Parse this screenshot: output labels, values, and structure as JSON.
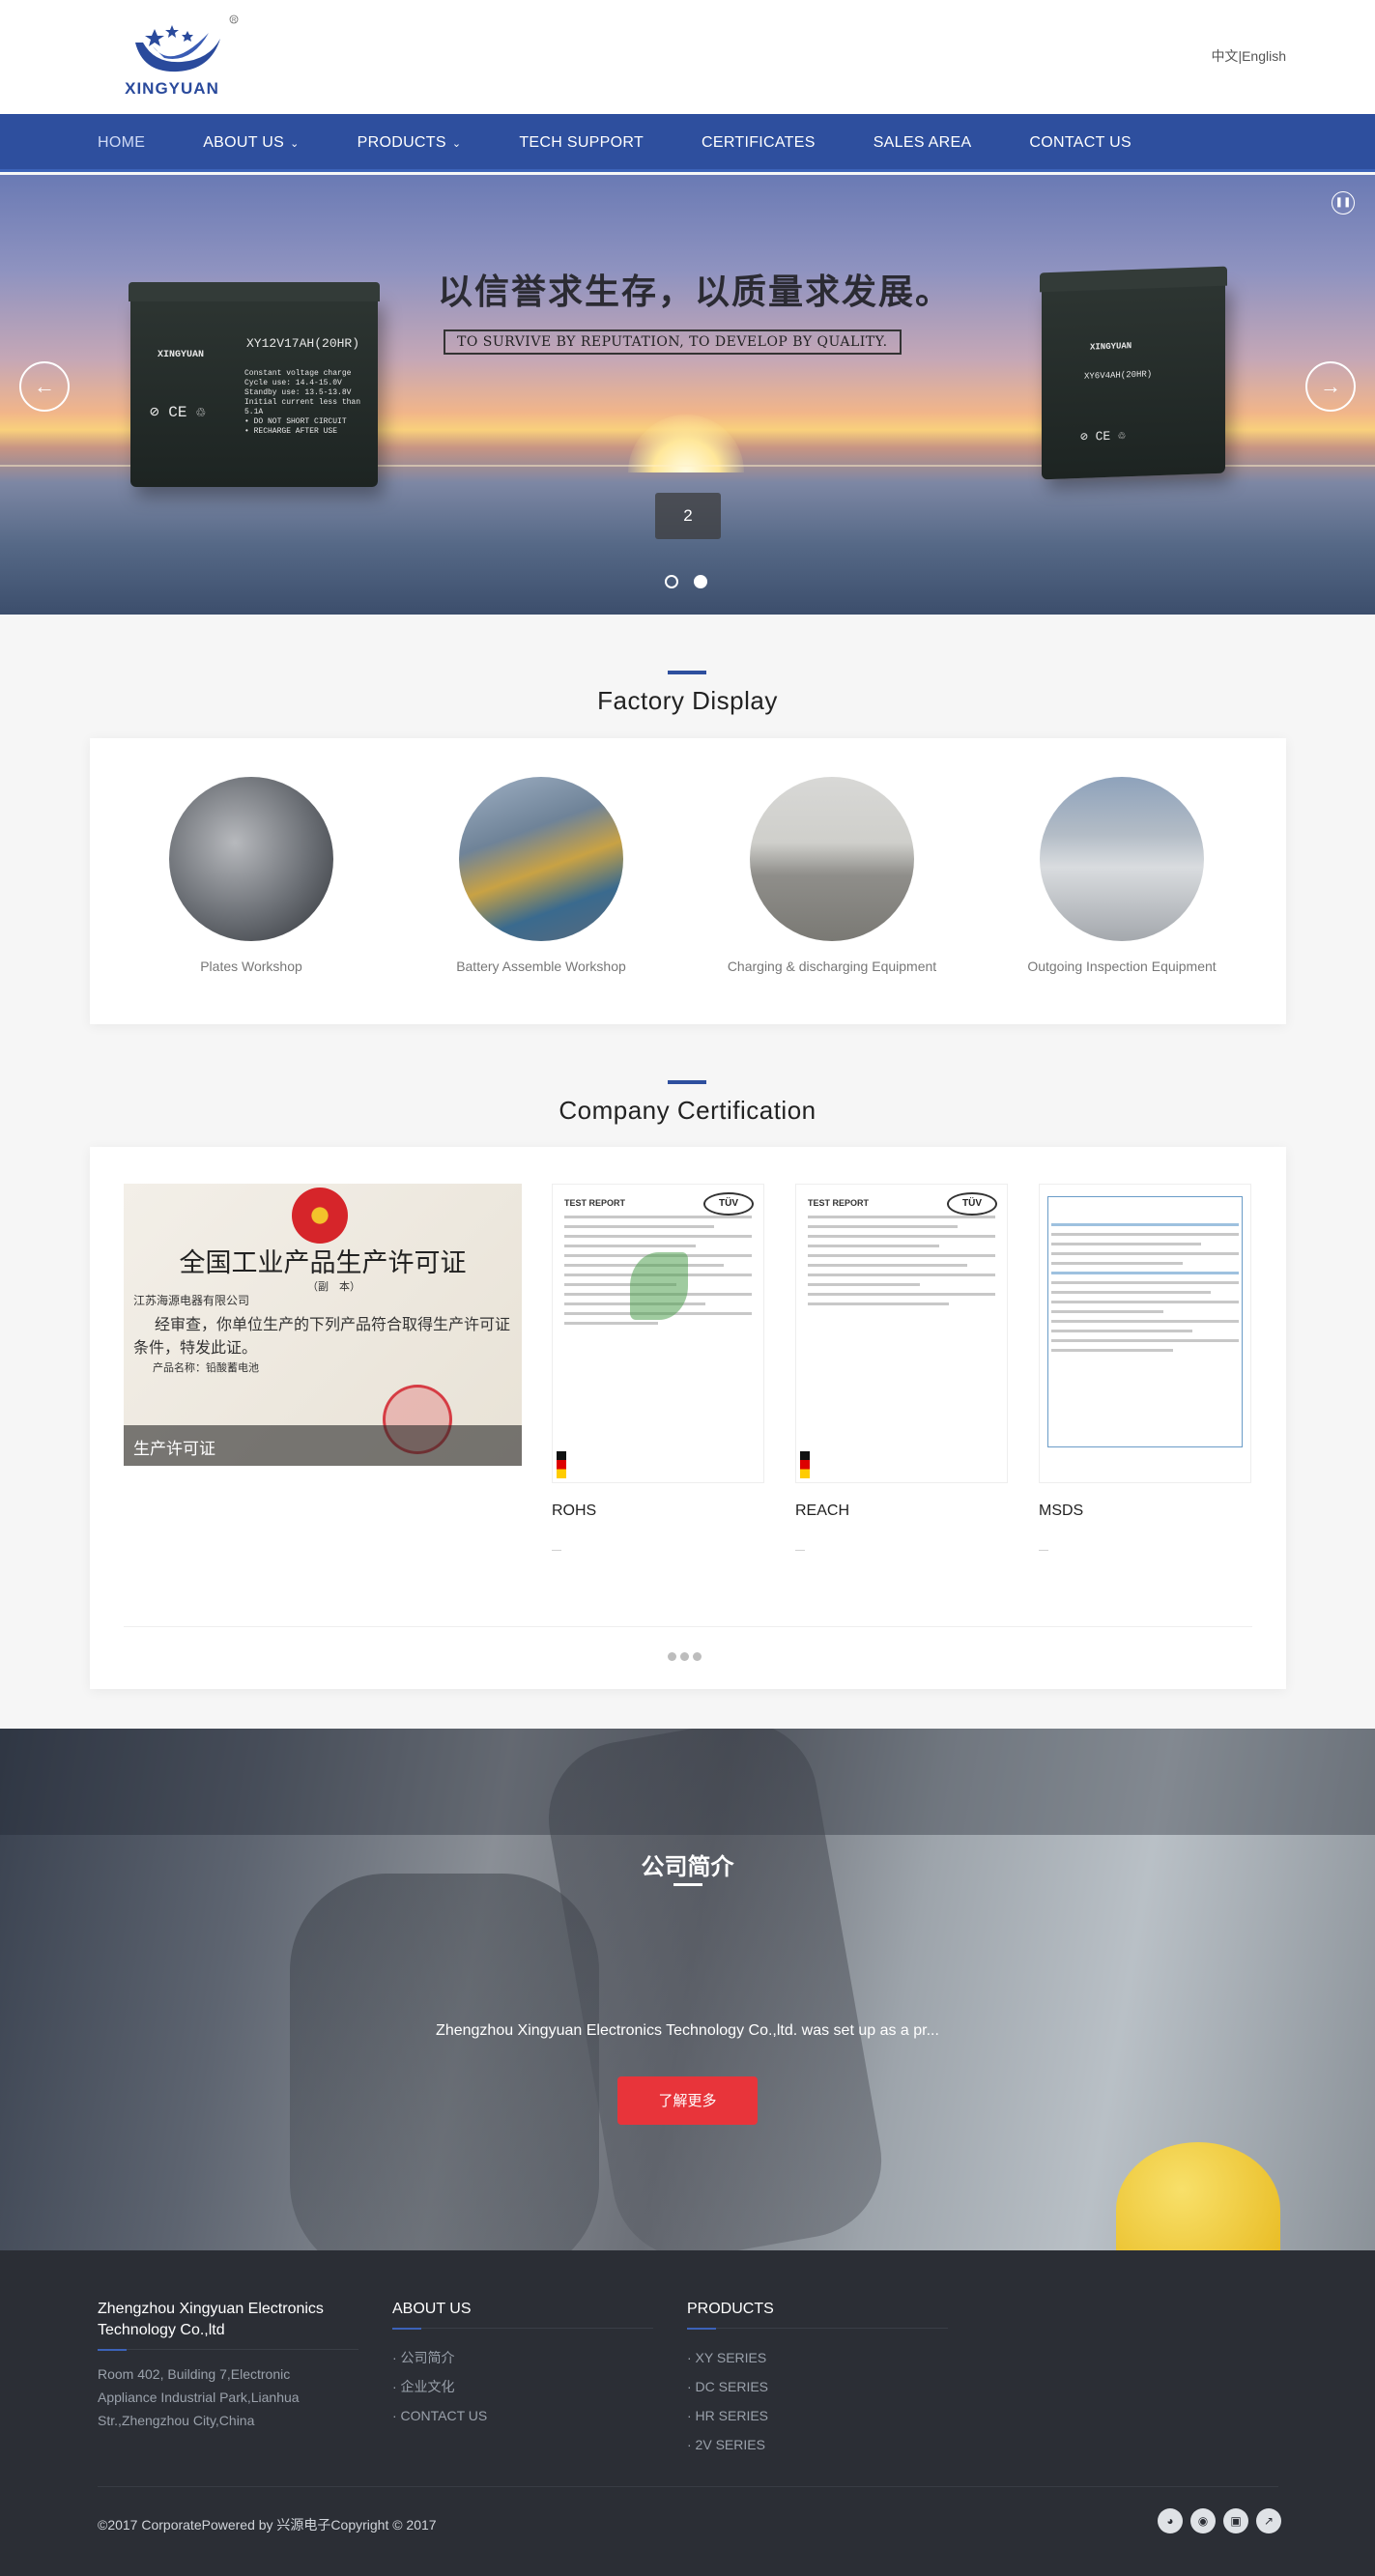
{
  "header": {
    "logo_text": "XINGYUAN",
    "lang": [
      "中文",
      "English"
    ],
    "lang_sep": "|"
  },
  "nav": {
    "items": [
      {
        "label": "HOME",
        "active": true
      },
      {
        "label": "ABOUT US",
        "dropdown": true
      },
      {
        "label": "PRODUCTS",
        "dropdown": true
      },
      {
        "label": "TECH SUPPORT"
      },
      {
        "label": "CERTIFICATES"
      },
      {
        "label": "SALES AREA"
      },
      {
        "label": "CONTACT US"
      }
    ]
  },
  "banner": {
    "slogan": "以信誉求生存，以质量求发展。",
    "slogan_en": "TO SURVIVE BY REPUTATION, TO DEVELOP BY QUALITY.",
    "slide_number": "2",
    "battery_left_model": "XY12V17AH(20HR)",
    "battery_left_brand": "XINGYUAN",
    "battery_left_specs": [
      "Constant voltage charge",
      "Cycle use:    14.4-15.0V",
      "Standby use:   13.5-13.8V",
      "Initial current less than 5.1A",
      "• DO NOT SHORT CIRCUIT",
      "• RECHARGE AFTER USE"
    ],
    "battery_right_model": "XY6V4AH(20HR)",
    "battery_right_brand": "XINGYUAN",
    "prev_icon": "arrow-left-icon",
    "next_icon": "arrow-right-icon",
    "pause_icon": "pause-icon",
    "dot_count": 2,
    "active_dot": 2
  },
  "factory": {
    "title": "Factory Display",
    "items": [
      {
        "caption": "Plates Workshop"
      },
      {
        "caption": "Battery Assemble Workshop"
      },
      {
        "caption": "Charging & discharging Equipment"
      },
      {
        "caption": "Outgoing Inspection Equipment"
      }
    ]
  },
  "certification": {
    "title": "Company Certification",
    "featured": {
      "title": "全国工业产品生产许可证",
      "subtitle": "（副　本）",
      "lines": [
        "江苏海源电器有限公司",
        "经审查，你单位生产的下列产品符合取得生产许可证",
        "条件，特发此证。",
        "产品名称：铅酸蓄电池"
      ],
      "caption": "生产许可证"
    },
    "items": [
      {
        "name": "ROHS",
        "dash": "—"
      },
      {
        "name": "REACH",
        "dash": "—"
      },
      {
        "name": "MSDS",
        "dash": "—"
      }
    ],
    "tuv": "TÜV",
    "doc_heading": "TEST REPORT"
  },
  "about": {
    "title": "公司简介",
    "text": "Zhengzhou Xingyuan Electronics Technology Co.,ltd. was set up as a pr...",
    "button": "了解更多"
  },
  "footer": {
    "company": "Zhengzhou Xingyuan Electronics Technology Co.,ltd",
    "address": "Room 402, Building 7,Electronic Appliance Industrial Park,Lianhua Str.,Zhengzhou City,China",
    "about_title": "ABOUT US",
    "about_links": [
      "· 公司简介",
      "· 企业文化",
      "· CONTACT US"
    ],
    "products_title": "PRODUCTS",
    "product_links": [
      "· XY SERIES",
      "· DC SERIES",
      "· HR SERIES",
      "· 2V SERIES"
    ],
    "copyright": "©2017 CorporatePowered by 兴源电子Copyright © 2017",
    "social_icons": [
      "qq-icon",
      "weibo-icon",
      "renren-icon",
      "share-icon"
    ]
  }
}
